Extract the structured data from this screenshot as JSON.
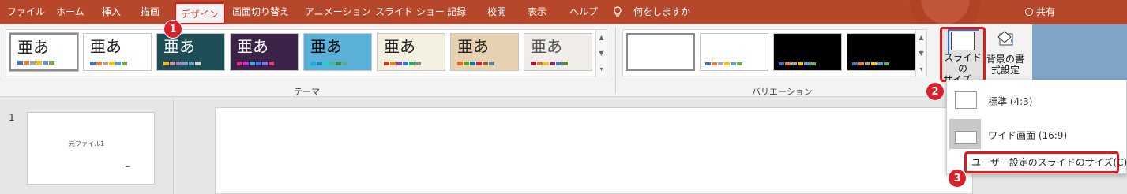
{
  "tabs": [
    "ファイル",
    "ホーム",
    "挿入",
    "描画",
    "デザイン",
    "画面切り替え",
    "アニメーション",
    "スライド ショー",
    "記録",
    "校閲",
    "表示",
    "ヘルプ"
  ],
  "tell_me": "何をしますか",
  "share": "共有",
  "theme_glyph": "亜あ",
  "themes_label": "テーマ",
  "variations_label": "バリエーション",
  "slide_size_button": "スライドの\nサイズ ⌄",
  "slide_size_line1": "スライドの",
  "slide_size_line2": "サイズ ⌄",
  "bg_format_line1": "背景の書",
  "bg_format_line2": "式設定",
  "dropdown": {
    "standard": "標準 (4:3)",
    "widescreen": "ワイド画面 (16:9)",
    "custom": "ユーザー設定のスライドのサイズ(C)..."
  },
  "slide_number": "1",
  "thumb_title": "元ファイル1",
  "badges": [
    "1",
    "2",
    "3"
  ],
  "colors": {
    "tab_bar": "#b7472a",
    "highlight_red": "#e01a1a",
    "badge_red": "#d9202b",
    "ribbon": "#f3f3f3"
  },
  "themes": [
    {
      "name": "office",
      "bg": "#ffffff",
      "fg": "#222222",
      "sw": [
        "#4472c4",
        "#ed7d31",
        "#a5a5a5",
        "#ffc000",
        "#5b9bd5",
        "#70ad47"
      ]
    },
    {
      "name": "office-2",
      "bg": "#ffffff",
      "fg": "#222222",
      "sw": [
        "#4472c4",
        "#ed7d31",
        "#a5a5a5",
        "#ffc000",
        "#5b9bd5",
        "#70ad47"
      ]
    },
    {
      "name": "teal-dark",
      "bg": "#1e4e55",
      "fg": "#ffffff",
      "sw": [
        "#e7bc29",
        "#d092a7",
        "#9c85c0",
        "#809ec2",
        "#6fa0c6",
        "#d0d0d0"
      ]
    },
    {
      "name": "purple",
      "bg": "#3a2346",
      "fg": "#ffffff",
      "sw": [
        "#e32d91",
        "#c830cc",
        "#4ea6dc",
        "#4775e7",
        "#8971e1",
        "#d54773"
      ]
    },
    {
      "name": "pattern-blue",
      "bg": "#5ab0d6",
      "fg": "#000000",
      "sw": [
        "#1cade4",
        "#2683c6",
        "#27ced7",
        "#42ba97",
        "#3e8853",
        "#62a39f"
      ]
    },
    {
      "name": "cream",
      "bg": "#f4f0e0",
      "fg": "#222222",
      "sw": [
        "#c0392b",
        "#e67e22",
        "#8e44ad",
        "#2980b9",
        "#27ae60",
        "#7f8c8d"
      ]
    },
    {
      "name": "wood",
      "bg": "#e6d2b1",
      "fg": "#222222",
      "sw": [
        "#de6c1f",
        "#6a9a1f",
        "#0e7c9c",
        "#bb2a3a",
        "#9b5c34",
        "#5a8a99"
      ]
    },
    {
      "name": "light-gray",
      "bg": "#f0ece8",
      "fg": "#555555",
      "sw": [
        "#a5163a",
        "#d07a2b",
        "#f0c040",
        "#7a2f6a",
        "#4b7ab5",
        "#5c8a3a"
      ]
    }
  ],
  "variations": [
    {
      "bg": "#ffffff",
      "sw": []
    },
    {
      "bg": "#ffffff",
      "sw": [
        "#4472c4",
        "#ed7d31",
        "#a5a5a5",
        "#ffc000",
        "#5b9bd5",
        "#70ad47"
      ]
    },
    {
      "bg": "#000000",
      "sw": [
        "#4472c4",
        "#ed7d31",
        "#a5a5a5",
        "#ffc000",
        "#5b9bd5",
        "#70ad47"
      ]
    },
    {
      "bg": "#000000",
      "sw": [
        "#4472c4",
        "#ed7d31",
        "#a5a5a5",
        "#ffc000",
        "#5b9bd5",
        "#70ad47"
      ]
    }
  ]
}
